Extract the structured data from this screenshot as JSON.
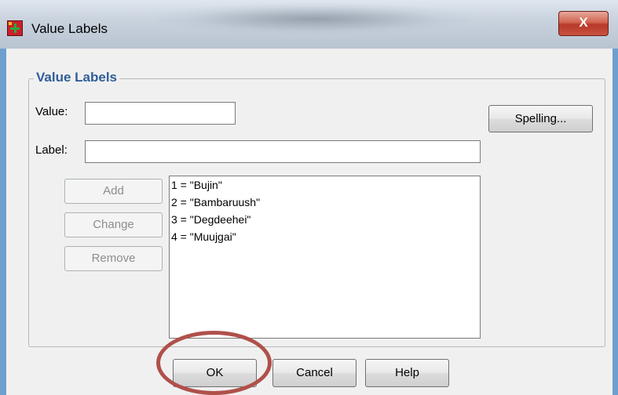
{
  "window": {
    "title": "Value Labels",
    "close_label": "X",
    "icon": "spss-grid-icon"
  },
  "group": {
    "title": "Value Labels"
  },
  "value": {
    "label": "Value:",
    "input_value": ""
  },
  "label_field": {
    "label": "Label:",
    "input_value": ""
  },
  "buttons": {
    "spelling": "Spelling...",
    "add": "Add",
    "change": "Change",
    "remove": "Remove",
    "ok": "OK",
    "cancel": "Cancel",
    "help": "Help"
  },
  "list": {
    "items": [
      "1 = \"Bujin\"",
      "2 = \"Bambaruush\"",
      "3 = \"Degdeehei\"",
      "4 = \"Muujgai\""
    ]
  },
  "colors": {
    "group_title": "#2f5e99",
    "highlight_circle": "#b0504a",
    "window_border": "#6f9fcf"
  }
}
